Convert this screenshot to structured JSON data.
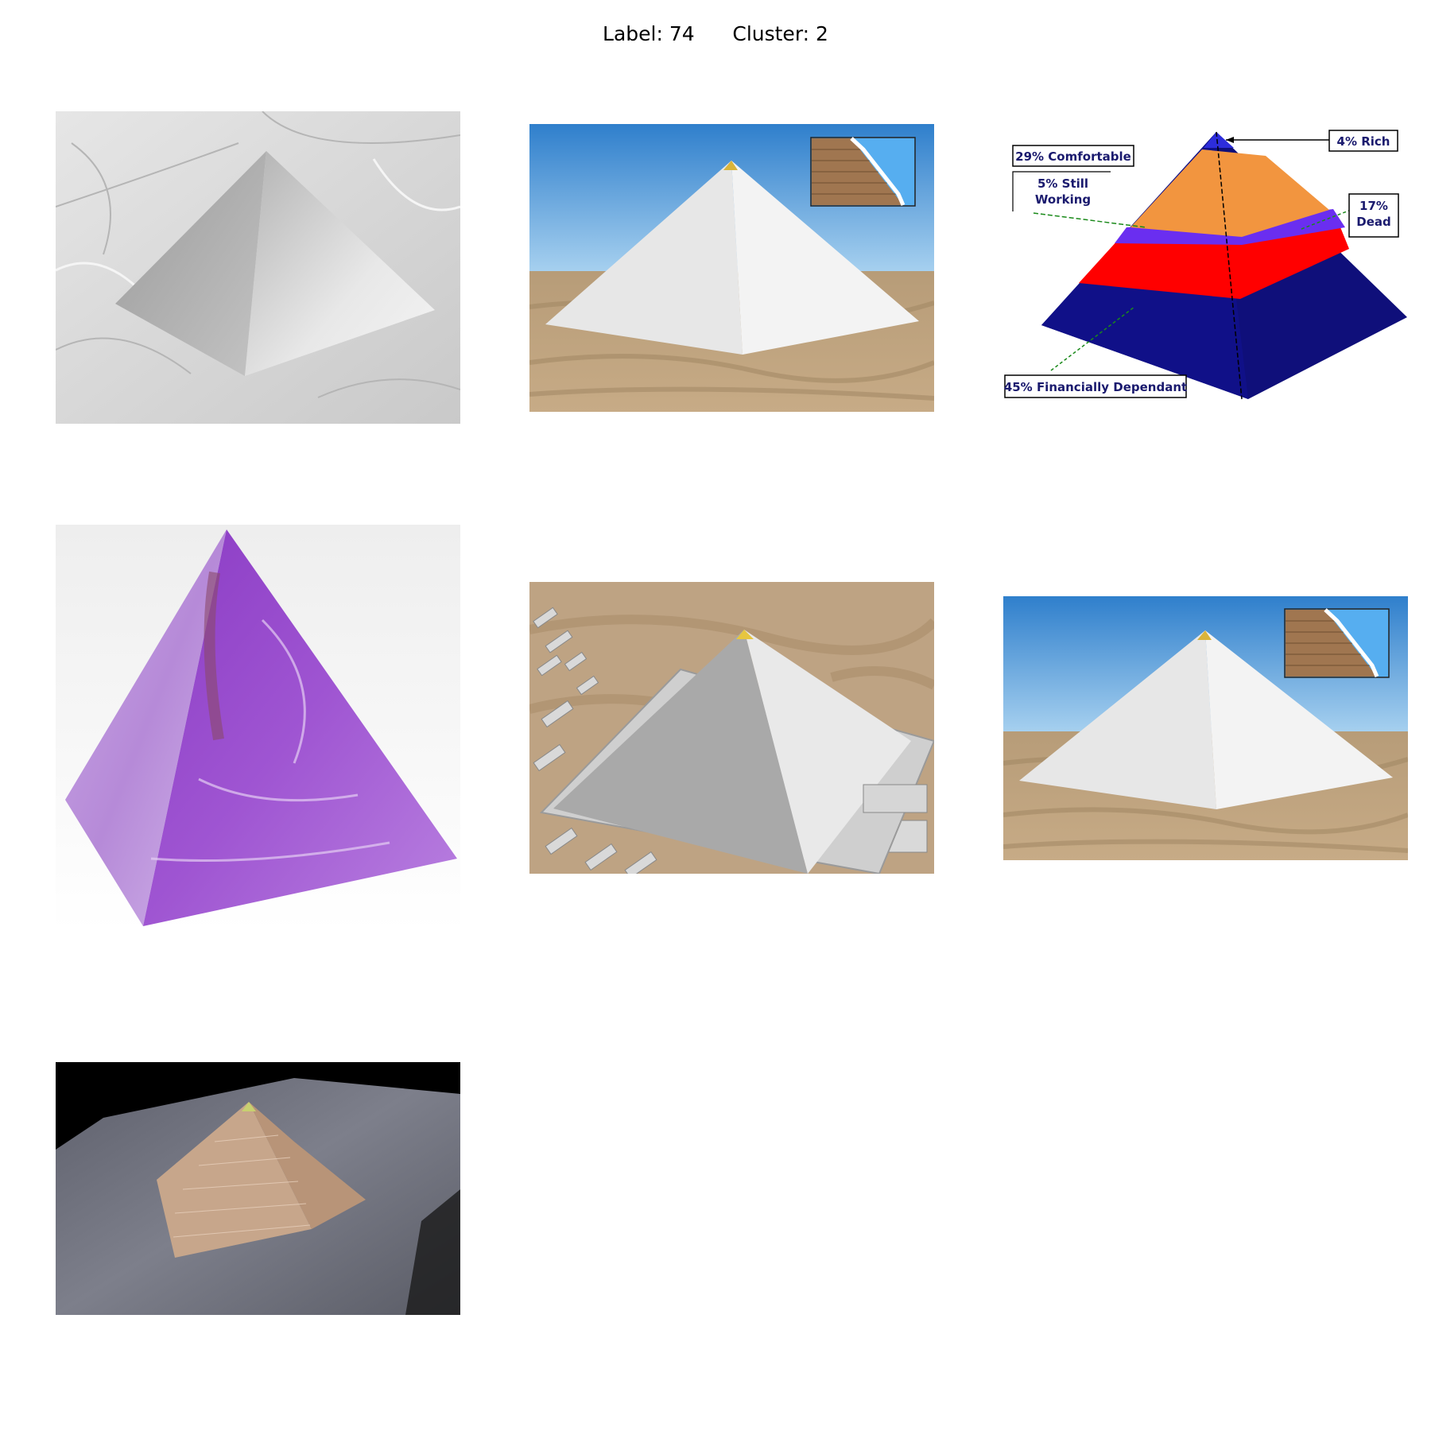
{
  "figure": {
    "label_text": "Label: 74",
    "cluster_text": "Cluster: 2"
  },
  "images": [
    {
      "subject": "brushed-metal-pyramid"
    },
    {
      "subject": "white-pyramid-desert-render"
    },
    {
      "subject": "wealth-pyramid-infographic",
      "labels": {
        "rich": "4% Rich",
        "comfortable": "29% Comfortable",
        "working_line1": "5% Still",
        "working_line2": "Working",
        "dead_line1": "17%",
        "dead_line2": "Dead",
        "dependant": "45% Financially Dependant"
      }
    },
    {
      "subject": "amethyst-crystal-pyramid"
    },
    {
      "subject": "pyramid-aerial-render"
    },
    {
      "subject": "white-pyramid-desert-render"
    },
    {
      "subject": "wooden-pyramid-model"
    }
  ]
}
